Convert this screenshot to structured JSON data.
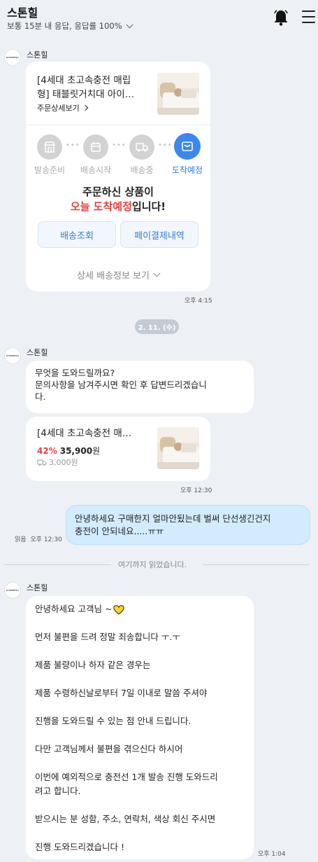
{
  "header": {
    "store_name": "스톤힐",
    "status": "보통 15분 내 응답, 응답률 100%"
  },
  "avatar_text": "STONEHILL",
  "messages": {
    "order_card": {
      "sender": "스톤힐",
      "product_title_line1": "[4세대 초고속충전 매립",
      "product_title_line2": "형] 태블릿거치대 아이…",
      "order_detail_link": "주문상세보기",
      "steps": [
        {
          "label": "발송준비",
          "icon": "store-icon",
          "active": false
        },
        {
          "label": "배송시작",
          "icon": "calendar-icon",
          "active": false
        },
        {
          "label": "배송중",
          "icon": "truck-icon",
          "active": false
        },
        {
          "label": "도착예정",
          "icon": "box-icon",
          "active": true
        }
      ],
      "notice_line1": "주문하신 상품이",
      "notice_highlight": "오늘 도착예정",
      "notice_suffix": "입니다!",
      "btn_track": "배송조회",
      "btn_pay": "페이결제내역",
      "detail_link": "상세 배송정보 보기",
      "time": "오후 4:15"
    },
    "date_divider": "2. 11. (수)",
    "greeting": {
      "sender": "스톤힐",
      "text": "무엇을 도와드릴까요?\n문의사항을 남겨주시면 확인 후 답변드리겠습니\n다.",
      "product_title": "[4세대 초고속충전 매…",
      "discount": "42%",
      "price": "35,900",
      "price_unit": "원",
      "shipping": "3,000원",
      "time": "오후 12:30"
    },
    "my_message": {
      "text": "안녕하세요 구매한지 얼마안됬는데 벌써 단선생긴건지\n충전이 안되네요.....ㅠㅠ",
      "read_label": "읽음",
      "time": "오후 12:30"
    },
    "read_divider": "여기까지 읽었습니다.",
    "reply": {
      "sender": "스톤힐",
      "paragraphs": [
        "안녕하세요 고객님 ~",
        "먼저 불편을 드려 정말 죄송합니다 ㅜ.ㅜ",
        "제품 불량이나 하자 같은 경우는",
        "제품 수령하신날로부터 7일 이내로 말씀 주셔야",
        "진행을 도와드릴 수 있는 점 안내 드립니다.",
        "다만 고객님께서 불편을 겪으신다 하시어",
        "이번에 예외적으로 충전선 1개 발송 진행 도와드리\n려고 합니다.",
        "받으시는 분 성함, 주소, 연락처, 색상 회신 주시면",
        "진행 도와드리겠습니다 !"
      ],
      "time": "오후 1:04"
    }
  },
  "colors": {
    "accent": "#3a87f2",
    "highlight": "#e64040",
    "my_bubble": "#d3ecfd",
    "background": "#edf0f5"
  }
}
